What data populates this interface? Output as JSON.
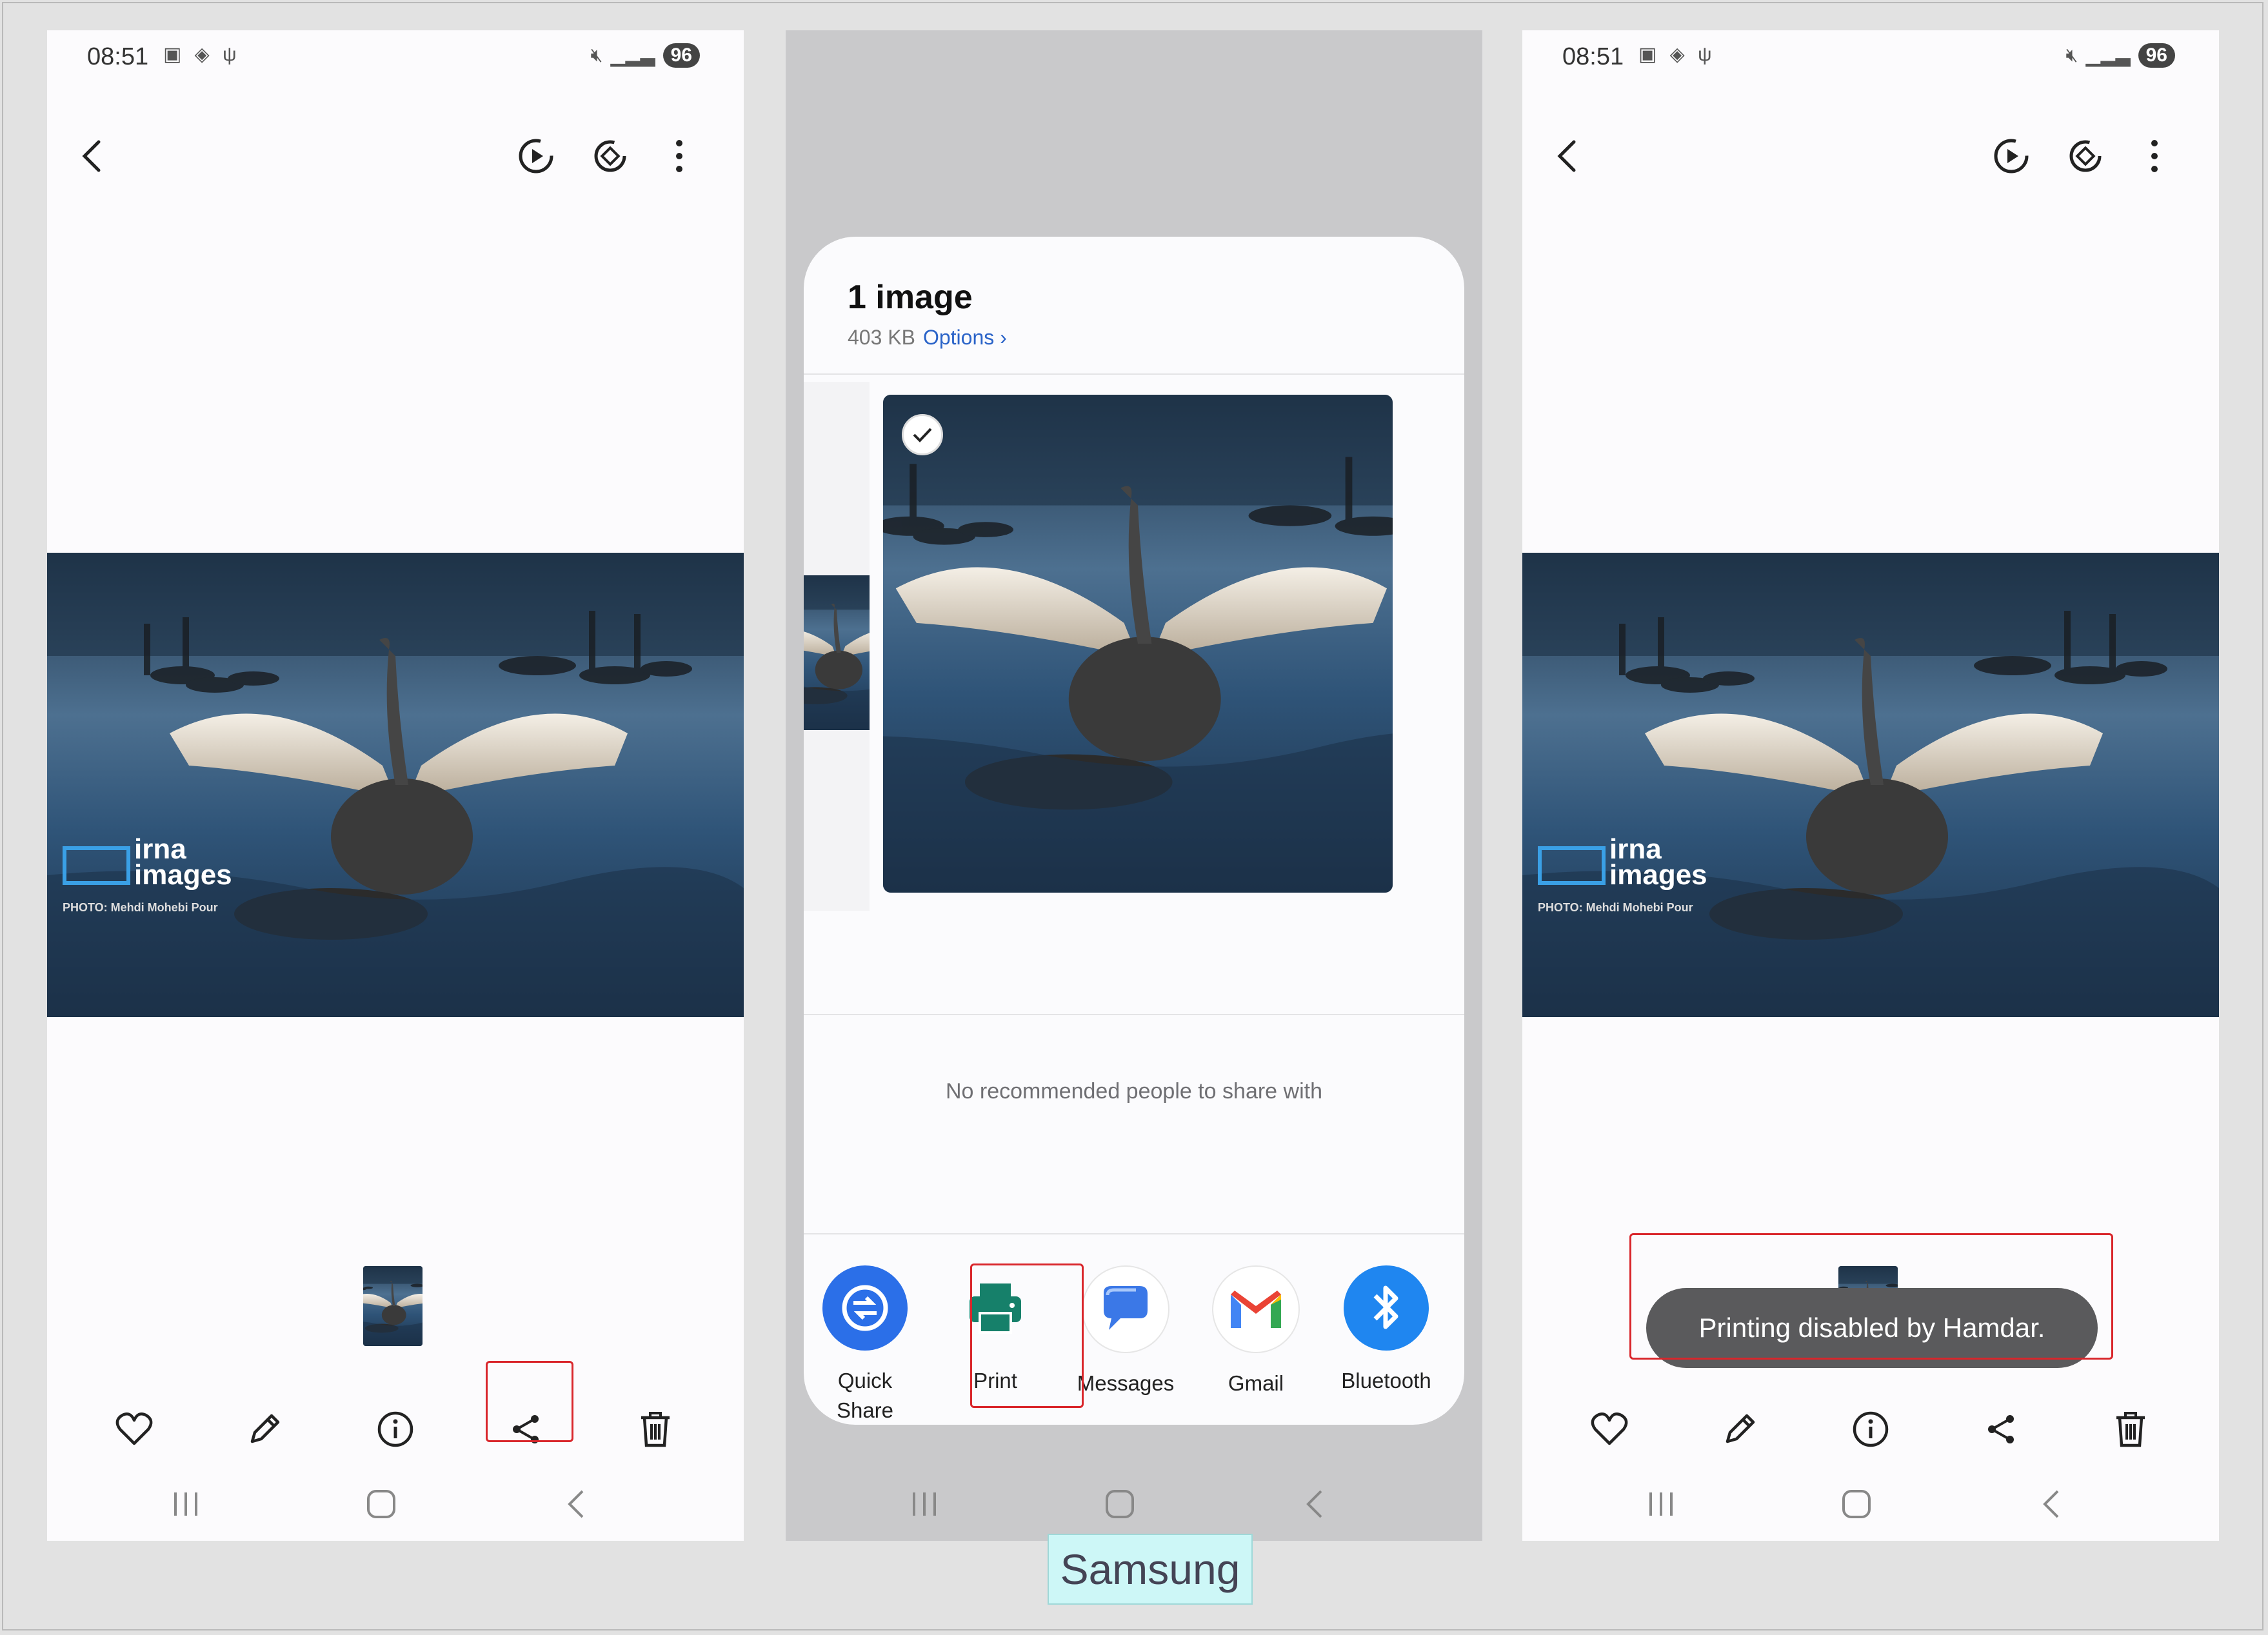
{
  "status_bar": {
    "time": "08:51",
    "battery": "96"
  },
  "caption": "Samsung",
  "photo": {
    "watermark_line1": "irna",
    "watermark_line2": "images",
    "credit": "PHOTO: Mehdi Mohebi Pour"
  },
  "share_sheet": {
    "title": "1 image",
    "size": "403 KB",
    "options_label": "Options",
    "no_recommended": "No recommended people to share with",
    "apps": [
      {
        "label_line1": "Quick",
        "label_line2": "Share"
      },
      {
        "label_line1": "Print",
        "label_line2": ""
      },
      {
        "label_line1": "Messages",
        "label_line2": ""
      },
      {
        "label_line1": "Gmail",
        "label_line2": ""
      },
      {
        "label_line1": "Bluetooth",
        "label_line2": ""
      }
    ]
  },
  "toast": "Printing disabled by Hamdar.",
  "colors": {
    "highlight": "#d9262b",
    "options_link": "#2a63c8"
  }
}
